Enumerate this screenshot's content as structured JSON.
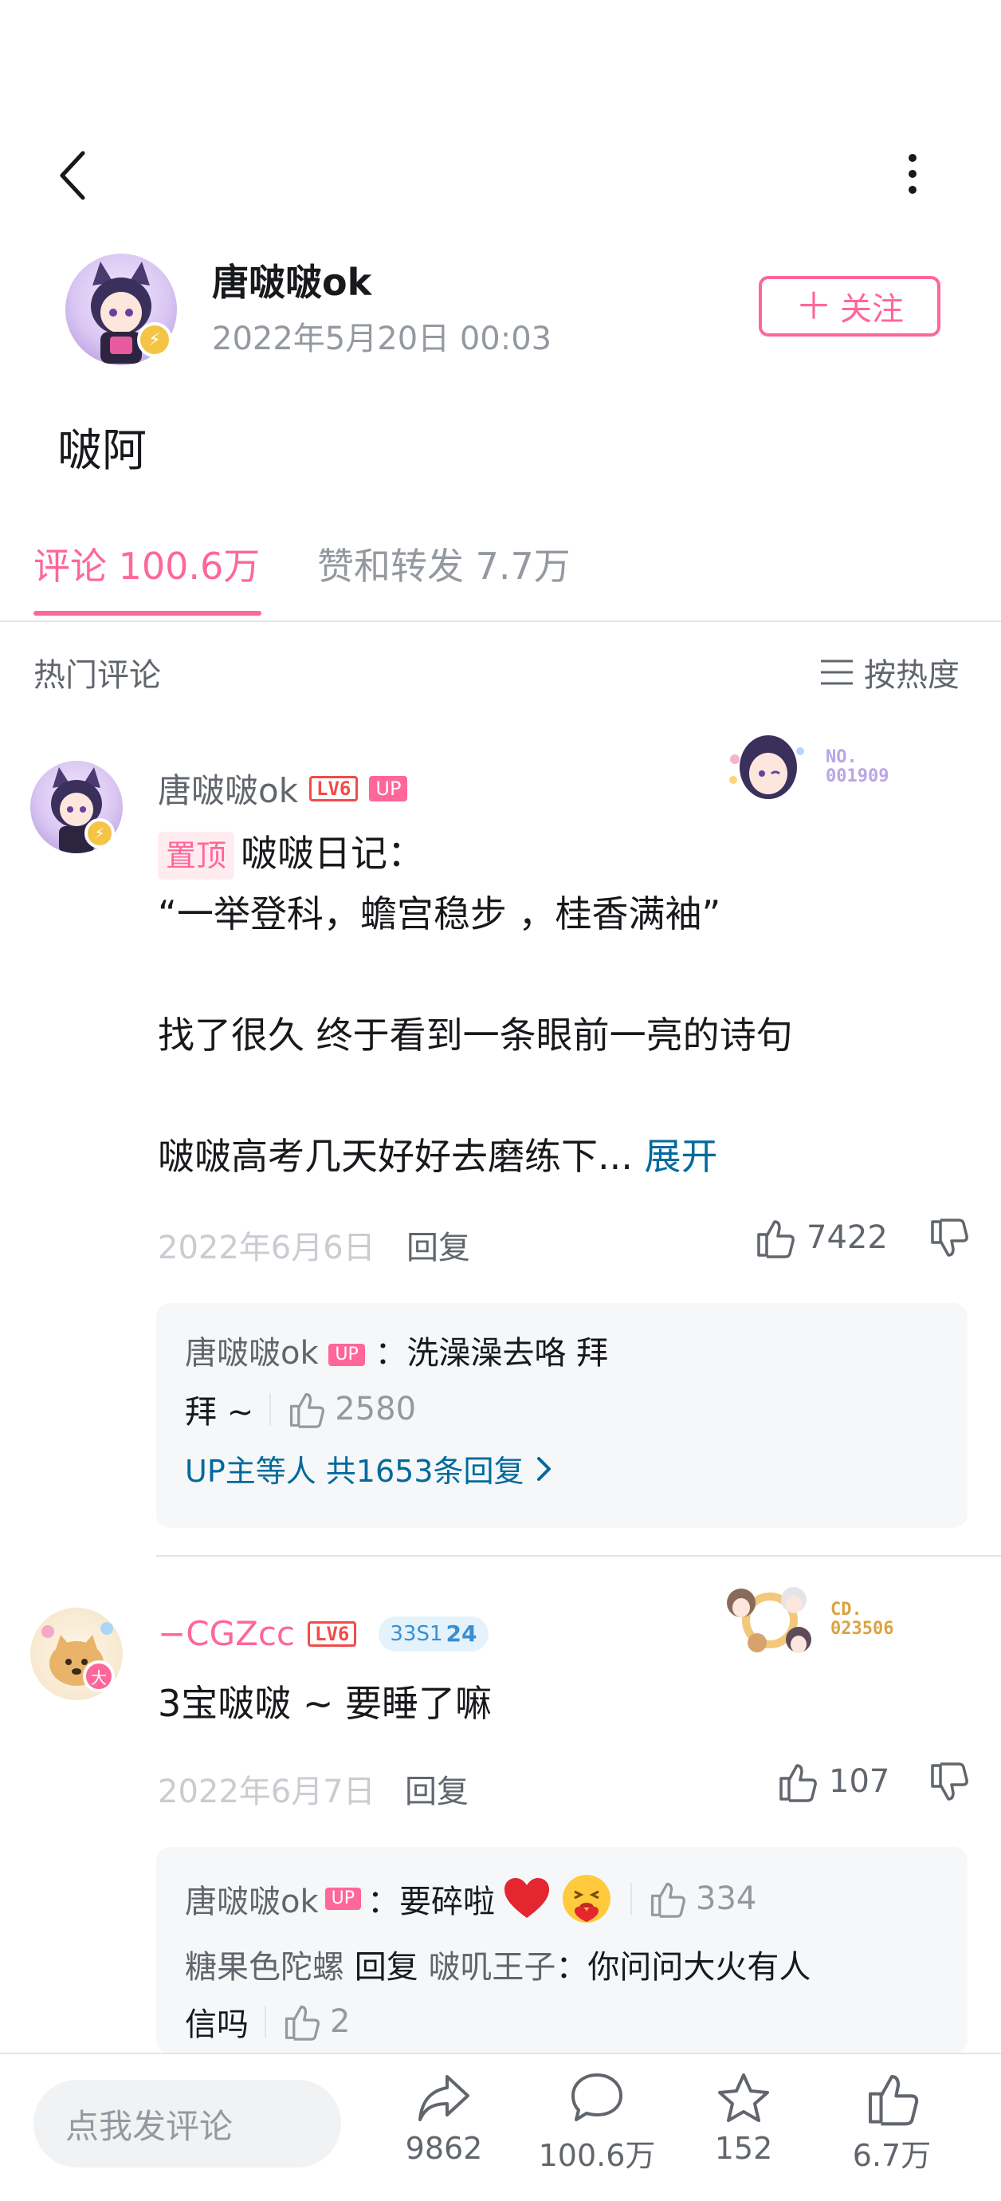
{
  "author": {
    "name": "唐啵啵ok",
    "time": "2022年5月20日 00:03",
    "follow_label": "关注"
  },
  "post": {
    "text": "啵阿"
  },
  "tabs": {
    "comments": "评论 100.6万",
    "likes_reposts": "赞和转发 7.7万"
  },
  "section": {
    "title": "热门评论",
    "sort_label": "按热度"
  },
  "comments": [
    {
      "user": "唐啵啵ok",
      "level": "LV6",
      "up_badge": "UP",
      "medal_no": "NO.",
      "medal_code": "001909",
      "pin_label": "置顶",
      "lines": [
        "啵啵日记：",
        "“一举登科，蟾宫稳步 ，桂香满袖”",
        "",
        "找了很久 终于看到一条眼前一亮的诗句",
        "",
        "啵啵高考几天好好去磨练下..."
      ],
      "expand_label": "展开",
      "date": "2022年6月6日",
      "reply_label": "回复",
      "likes": "7422",
      "replies": [
        {
          "user": "唐啵啵ok",
          "up_badge": "UP",
          "text_1": "：洗澡澡去咯  拜",
          "text_2": "拜 ~",
          "likes": "2580"
        }
      ],
      "more_replies": "UP主等人 共1653条回复"
    },
    {
      "user": "−CGZcc",
      "level": "LV6",
      "fan_badge_a": "33S1",
      "fan_badge_b": "24",
      "medal_no": "CD.",
      "medal_code": "023506",
      "text": "3宝啵啵 ~ 要睡了嘛",
      "date": "2022年6月7日",
      "reply_label": "回复",
      "likes": "107",
      "replies": [
        {
          "user": "唐啵啵ok",
          "up_badge": "UP",
          "text": "：要碎啦",
          "likes": "334"
        },
        {
          "user": "糖果色陀螺",
          "reply_word": "回复",
          "target": "啵叽王子",
          "text": "：你问问大火有人",
          "text_2": "信吗",
          "likes": "2"
        }
      ]
    }
  ],
  "bottom_bar": {
    "input_placeholder": "点我发评论",
    "share_count": "9862",
    "comment_count": "100.6万",
    "favorite_count": "152",
    "like_count": "6.7万"
  },
  "colors": {
    "accent_pink": "#ff6699",
    "link_blue": "#00699d",
    "level_red": "#f04c49",
    "text_gray": "#9499a0"
  },
  "icons": [
    "back-icon",
    "more-icon",
    "plus-icon",
    "sort-icon",
    "thumb-up-icon",
    "thumb-down-icon",
    "chevron-right-icon",
    "share-icon",
    "comment-icon",
    "star-icon",
    "heart-icon",
    "emoji-icon"
  ]
}
